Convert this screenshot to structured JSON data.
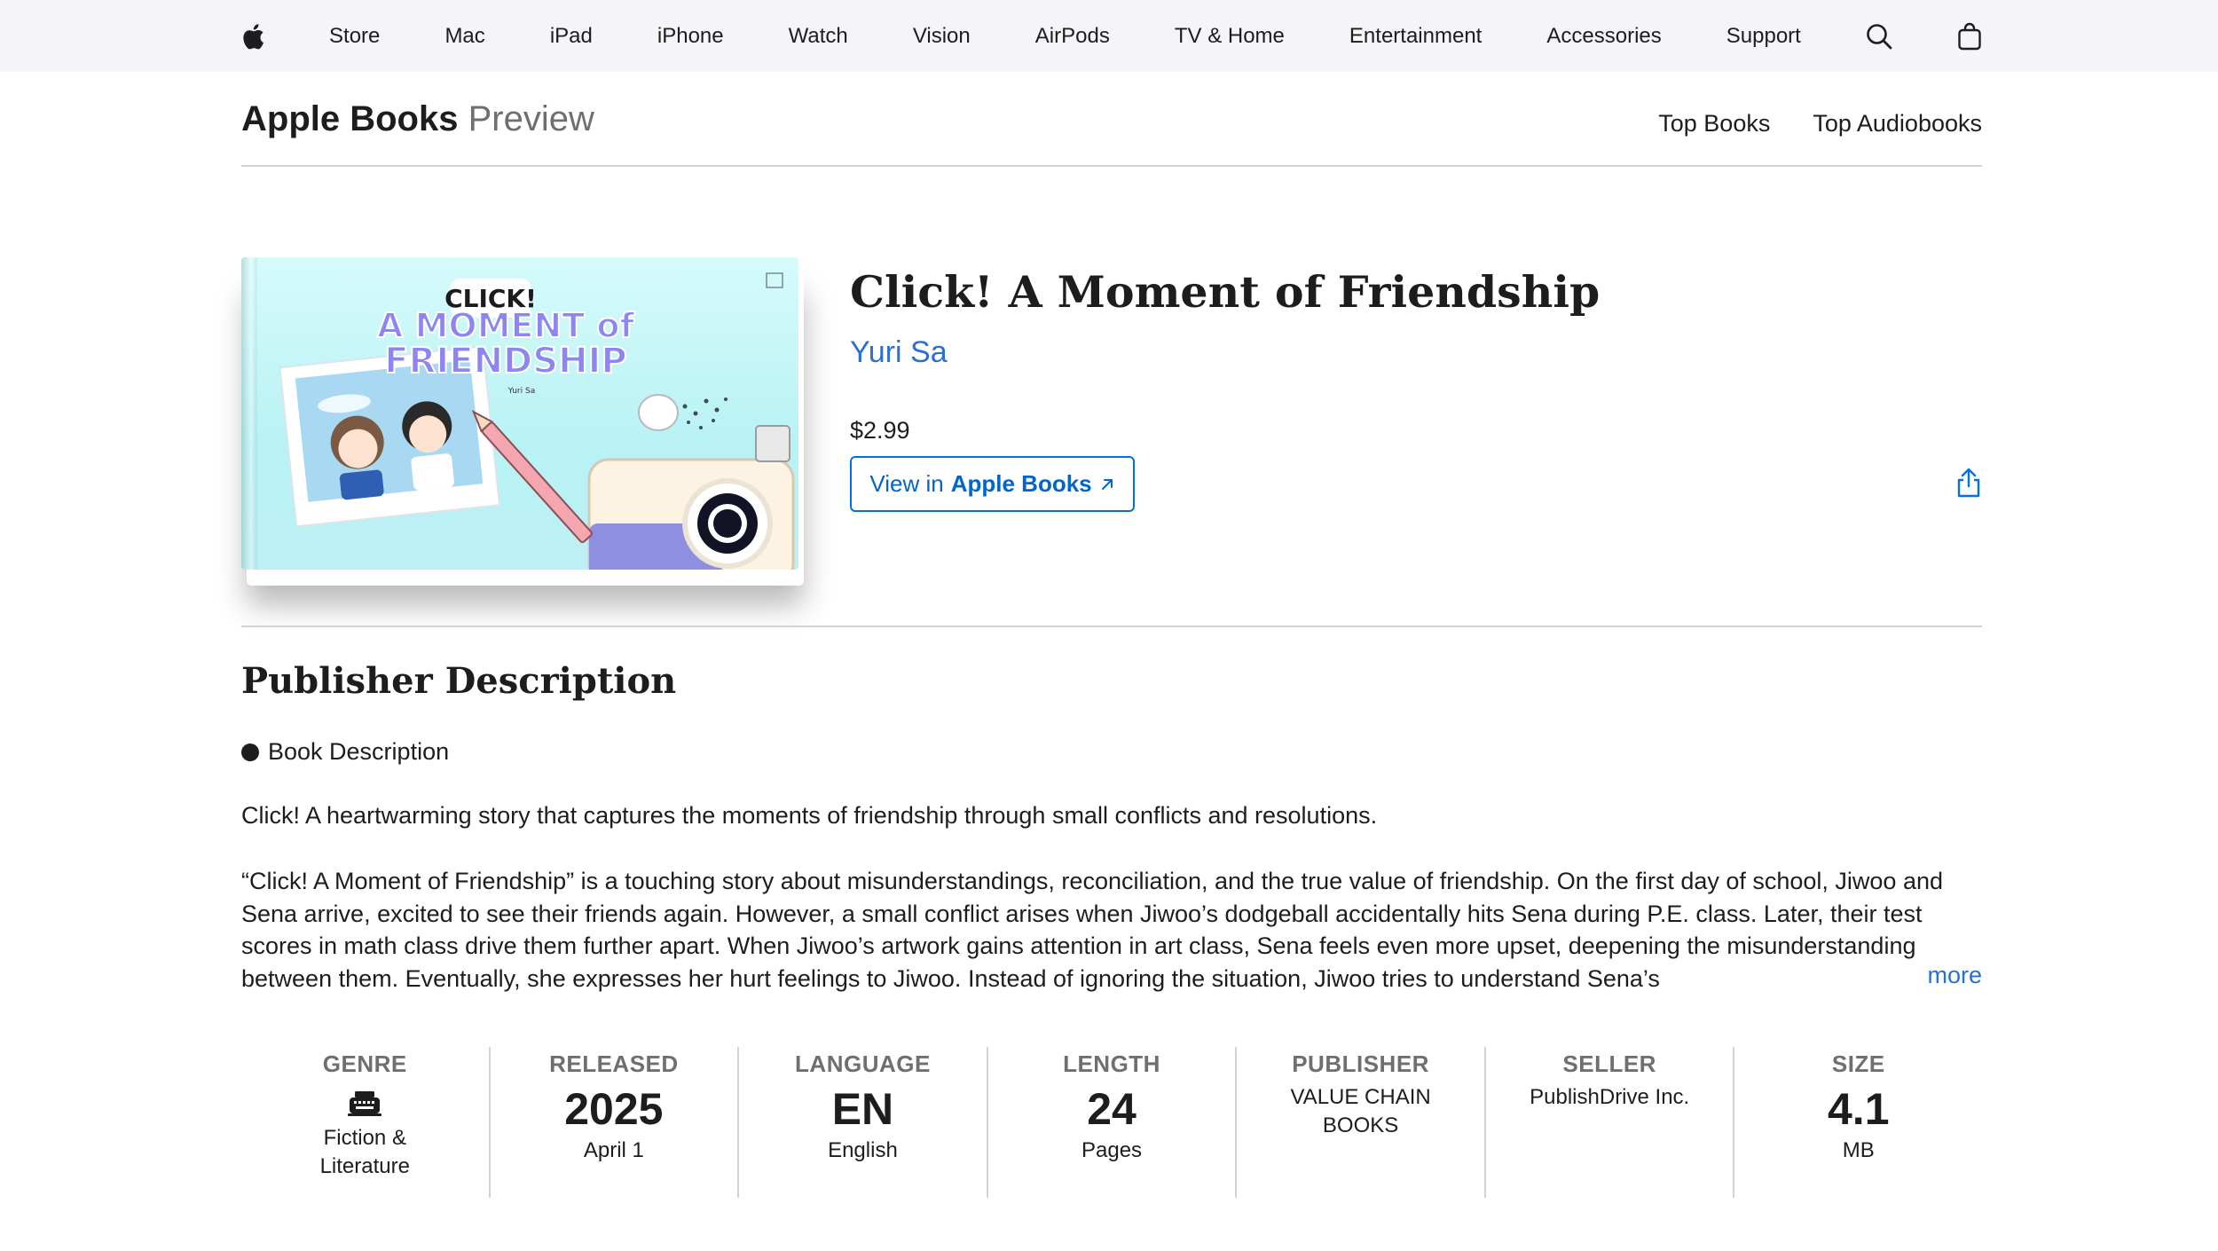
{
  "globalnav": {
    "logo_icon": "apple-logo-icon",
    "items": [
      "Store",
      "Mac",
      "iPad",
      "iPhone",
      "Watch",
      "Vision",
      "AirPods",
      "TV & Home",
      "Entertainment",
      "Accessories",
      "Support"
    ],
    "search_icon": "search-icon",
    "bag_icon": "shopping-bag-icon"
  },
  "localnav": {
    "brand_strong": "Apple Books",
    "brand_light": "Preview",
    "links": [
      "Top Books",
      "Top Audiobooks"
    ]
  },
  "cover": {
    "headline_top": "CLICK!",
    "headline_mid": "A MOMENT of",
    "headline_bottom": "FRIENDSHIP",
    "byline": "Yuri Sa"
  },
  "book": {
    "title": "Click! A Moment of Friendship",
    "author": "Yuri Sa",
    "price": "$2.99",
    "view_prefix": "View in",
    "view_strong": "Apple Books",
    "share_icon": "share-icon"
  },
  "description": {
    "heading": "Publisher Description",
    "bullet": "Book Description",
    "lead": "Click! A heartwarming story that captures the moments of friendship through small conflicts and resolutions.",
    "body": "“Click! A Moment of Friendship” is a touching story about misunderstandings, reconciliation, and the true value of friendship. On the first day of school, Jiwoo and Sena arrive, excited to see their friends again. However, a small conflict arises when Jiwoo’s dodgeball accidentally hits Sena during P.E. class. Later, their test scores in math class drive them further apart. When Jiwoo’s artwork gains attention in art class, Sena feels even more upset, deepening the misunderstanding between them. Eventually, she expresses her hurt feelings to Jiwoo. Instead of ignoring the situation, Jiwoo tries to understand Sena’s",
    "more": "more"
  },
  "info": {
    "genre": {
      "label": "GENRE",
      "icon": "typewriter-icon",
      "value": "Fiction & Literature"
    },
    "released": {
      "label": "RELEASED",
      "big": "2025",
      "sub": "April 1"
    },
    "language": {
      "label": "LANGUAGE",
      "big": "EN",
      "sub": "English"
    },
    "length": {
      "label": "LENGTH",
      "big": "24",
      "sub": "Pages"
    },
    "publisher": {
      "label": "PUBLISHER",
      "value": "VALUE CHAIN BOOKS"
    },
    "seller": {
      "label": "SELLER",
      "value": "PublishDrive Inc."
    },
    "size": {
      "label": "SIZE",
      "big": "4.1",
      "sub": "MB"
    }
  },
  "colors": {
    "link": "#2b6fd1",
    "button_border": "#0071e3",
    "nav_bg": "#f5f5f7",
    "divider": "#d2d2d7"
  }
}
